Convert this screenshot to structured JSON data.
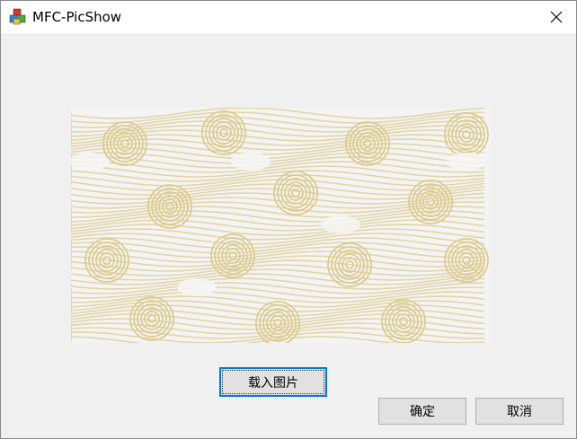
{
  "window": {
    "title": "MFC-PicShow",
    "app_icon": "mfc-app-icon",
    "close_icon": "close-icon"
  },
  "image": {
    "description_icon": "wave-pattern-image",
    "pattern_color": "#dccb8f",
    "background_color": "#f4f4f4"
  },
  "buttons": {
    "load_label": "载入图片",
    "ok_label": "确定",
    "cancel_label": "取消"
  },
  "colors": {
    "dialog_bg": "#f0f0f0",
    "titlebar_bg": "#ffffff",
    "button_bg": "#e1e1e1",
    "focus_border": "#0078d7"
  }
}
